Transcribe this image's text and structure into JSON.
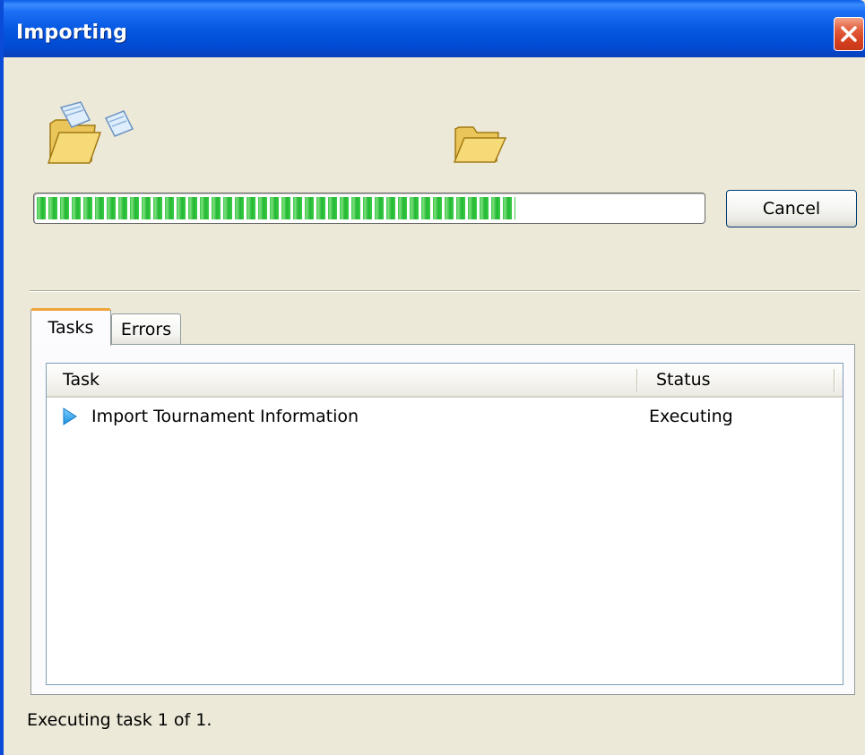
{
  "window": {
    "title": "Importing",
    "close_icon": "close-icon"
  },
  "icons": {
    "source": "folder-open-with-file-icon",
    "destination": "folder-open-icon"
  },
  "progress": {
    "percent": 72
  },
  "buttons": {
    "cancel_label": "Cancel"
  },
  "tabs": [
    {
      "label": "Tasks",
      "selected": true
    },
    {
      "label": "Errors",
      "selected": false
    }
  ],
  "task_list": {
    "columns": [
      "Task",
      "Status"
    ],
    "rows": [
      {
        "icon": "play-arrow-icon",
        "task": "Import Tournament Information",
        "status": "Executing"
      }
    ]
  },
  "status_bar": {
    "text": "Executing task 1 of 1."
  },
  "colors": {
    "titlebar": "#0456e0",
    "dialog_bg": "#ece9d8",
    "progress_fill": "#2fc43f",
    "tab_highlight": "#f0a43a",
    "close_button": "#d6401f"
  }
}
